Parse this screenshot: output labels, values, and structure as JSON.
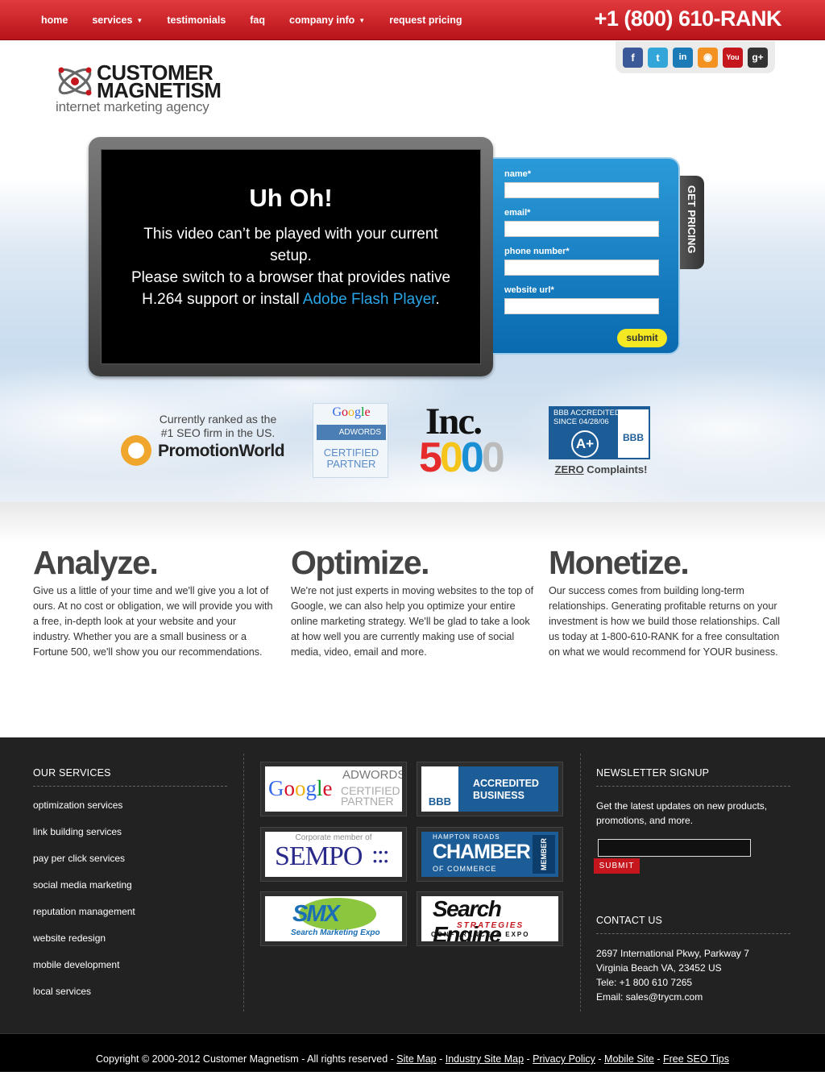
{
  "nav": {
    "items": [
      {
        "label": "home"
      },
      {
        "label": "services",
        "caret": "▼"
      },
      {
        "label": "testimonials"
      },
      {
        "label": "faq"
      },
      {
        "label": "company info",
        "caret": "▼"
      },
      {
        "label": "request pricing"
      }
    ],
    "phone": "+1 (800) 610-RANK"
  },
  "brand": {
    "line1": "CUSTOMER",
    "line2": "MAGNETISM",
    "tagline": "internet marketing agency"
  },
  "social": {
    "icons": [
      {
        "name": "facebook-icon",
        "glyph": "f",
        "color": "#3b5998"
      },
      {
        "name": "twitter-icon",
        "glyph": "t",
        "color": "#33a6d9"
      },
      {
        "name": "linkedin-icon",
        "glyph": "in",
        "color": "#1c7ab7"
      },
      {
        "name": "rss-icon",
        "glyph": "◉",
        "color": "#f39221"
      },
      {
        "name": "youtube-icon",
        "glyph": "You",
        "color": "#c4161c"
      },
      {
        "name": "googleplus-icon",
        "glyph": "g+",
        "color": "#333333"
      }
    ]
  },
  "video": {
    "title": "Uh Oh!",
    "msg1": "This video can’t be played with your current setup.",
    "msg2": "Please switch to a browser that provides native H.264 support or install ",
    "link": "Adobe Flash Player",
    "end": "."
  },
  "pricing": {
    "fields": [
      {
        "label": "name*"
      },
      {
        "label": "email*"
      },
      {
        "label": "phone number*"
      },
      {
        "label": "website url*"
      }
    ],
    "submit": "submit",
    "tab": "GET PRICING"
  },
  "badges": {
    "promo_line1": "Currently ranked as the",
    "promo_line2": "#1 SEO firm in the US.",
    "promo_name": "PromotionWorld",
    "google": "Google",
    "adwords": "ADWORDS",
    "certified": "CERTIFIED",
    "partner": "PARTNER",
    "inc": "Inc.",
    "inc_num": "5000",
    "bbb_line1": "BBB ACCREDITED",
    "bbb_line2": "SINCE 04/28/06",
    "bbb_grade": "A+",
    "bbb_label": "BBB",
    "bbb_zero": "ZERO",
    "bbb_complaints": " Complaints!"
  },
  "pillars": [
    {
      "title": "Analyze.",
      "text": "Give us a little of your time and we'll give you a lot of ours. At no cost or obligation, we will provide you with a free, in-depth look at your website and your industry. Whether you are a small business or a Fortune 500, we'll show you our recommendations."
    },
    {
      "title": "Optimize.",
      "text": "We're not just experts in moving websites to the top of Google, we can also help you optimize your entire online marketing strategy. We'll be glad to take a look at how well you are currently making use of social media, video, email and more."
    },
    {
      "title": "Monetize.",
      "text": "Our success comes from building long-term relationships. Generating profitable returns on your investment is how we build those relationships. Call us today at 1-800-610-RANK for a free consultation on what we would recommend for YOUR business."
    }
  ],
  "footer": {
    "services_heading": "OUR SERVICES",
    "services": [
      "optimization services",
      "link building services",
      "pay per click services",
      "social media marketing",
      "reputation management",
      "website redesign",
      "mobile development",
      "local services"
    ],
    "tiles": {
      "adwords_google": "Google",
      "adwords_word": "ADWORDS",
      "adwords_cert": "CERTIFIED",
      "adwords_partner": "PARTNER",
      "bbb_label": "BBB",
      "bbb_text1": "ACCREDITED",
      "bbb_text2": "BUSINESS",
      "sempo_small": "Corporate member of",
      "sempo": "SEMPO",
      "chamber_top": "HAMPTON ROADS",
      "chamber": "CHAMBER",
      "chamber_bottom": "OF COMMERCE",
      "chamber_member": "MEMBER",
      "smx": "SMX",
      "smx_sub": "Search Marketing Expo",
      "ses_main": "Search Engine",
      "ses_mid": "STRATEGIES",
      "ses_bottom": "CONFERENCE & EXPO"
    },
    "newsletter_heading": "NEWSLETTER SIGNUP",
    "newsletter_text": "Get the latest updates on new products, promotions, and more.",
    "newsletter_submit": "SUBMIT",
    "contact_heading": "CONTACT US",
    "contact_lines": [
      "2697 International Pkwy, Parkway 7",
      "Virginia Beach VA, 23452 US",
      "Tele: +1 800 610 7265",
      "Email: sales@trycm.com"
    ]
  },
  "copyright": {
    "text": "Copyright © 2000-2012 Customer Magnetism - All rights reserved - ",
    "links": [
      "Site Map",
      "Industry Site Map",
      "Privacy Policy",
      "Mobile Site",
      "Free SEO Tips"
    ],
    "sep": " - "
  },
  "colors": {
    "brand_red": "#c4161c",
    "form_blue": "#1a7fc3",
    "submit_yellow": "#f3e821",
    "footer_bg": "#222222"
  }
}
